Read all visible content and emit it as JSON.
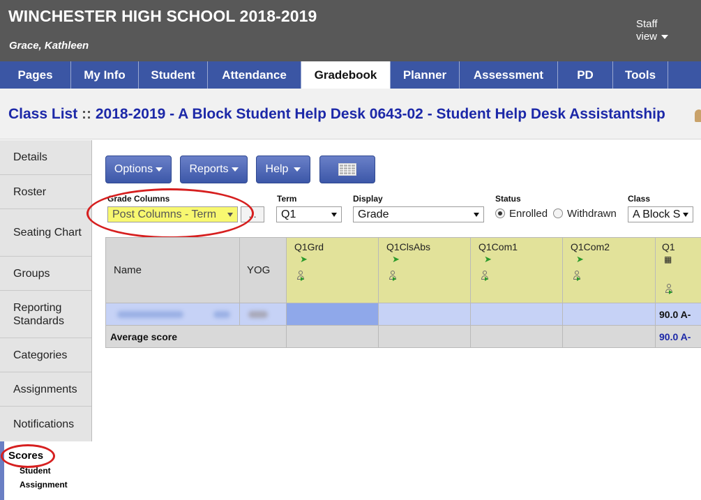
{
  "header": {
    "school": "WINCHESTER HIGH SCHOOL 2018-2019",
    "user": "Grace, Kathleen",
    "staff_view_line1": "Staff",
    "staff_view_line2": "view"
  },
  "tabs": [
    {
      "label": "Pages"
    },
    {
      "label": "My Info"
    },
    {
      "label": "Student"
    },
    {
      "label": "Attendance"
    },
    {
      "label": "Gradebook",
      "active": true
    },
    {
      "label": "Planner"
    },
    {
      "label": "Assessment"
    },
    {
      "label": "PD"
    },
    {
      "label": "Tools"
    }
  ],
  "title": {
    "prefix": "Class List",
    "separator": " :: ",
    "rest": "2018-2019 - A Block Student Help Desk 0643-02 - Student Help Desk Assistantship"
  },
  "leftnav": {
    "items": [
      {
        "label": "Details"
      },
      {
        "label": "Roster"
      },
      {
        "label": "Seating Chart"
      },
      {
        "label": "Groups"
      },
      {
        "label": "Reporting Standards"
      },
      {
        "label": "Categories"
      },
      {
        "label": "Assignments"
      },
      {
        "label": "Notifications"
      }
    ],
    "scores": "Scores",
    "sub_line1": "Student",
    "sub_line2": "Assignment"
  },
  "toolbar": {
    "options_label": "Options",
    "reports_label": "Reports",
    "help_label": "Help",
    "grid_icon": "grid-view-icon"
  },
  "filters": {
    "grade_columns_label": "Grade Columns",
    "grade_columns_value": "Post Columns - Term",
    "dots_label": "...",
    "term_label": "Term",
    "term_value": "Q1",
    "display_label": "Display",
    "display_value": "Grade",
    "status_label": "Status",
    "enrolled_label": "Enrolled",
    "withdrawn_label": "Withdrawn",
    "status_selected": "Enrolled",
    "class_label": "Class",
    "class_value": "A Block S"
  },
  "table": {
    "headers": {
      "name": "Name",
      "yog": "YOG",
      "cols": [
        "Q1Grd",
        "Q1ClsAbs",
        "Q1Com1",
        "Q1Com2"
      ],
      "last": "Q1"
    },
    "student_row": {
      "score": "90.0 A-"
    },
    "average_row": {
      "label": "Average score",
      "score": "90.0 A-"
    }
  },
  "colors": {
    "header_bg": "#585858",
    "tab_bg": "#3b56a4",
    "title_color": "#1c28a8",
    "highlight_yellow": "#f8f870",
    "column_header_bg": "#e2e29a",
    "selected_row_bg": "#c6d2f6",
    "annotation_red": "#d61f1f"
  }
}
